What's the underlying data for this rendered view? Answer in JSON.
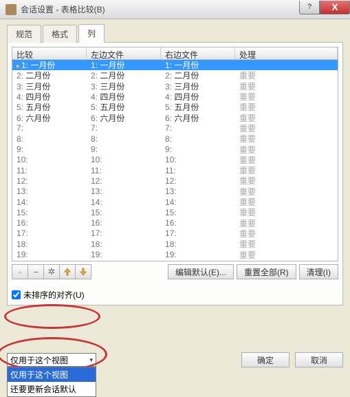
{
  "window": {
    "title": "会话设置 - 表格比较(B)",
    "help_glyph": "?",
    "close_glyph": "X"
  },
  "tabs": [
    {
      "label": "规范"
    },
    {
      "label": "格式"
    },
    {
      "label": "列",
      "active": true
    }
  ],
  "columns": {
    "compare": "比较",
    "left": "左边文件",
    "right": "右边文件",
    "handle": "处理"
  },
  "rows": [
    {
      "idx": "1:",
      "compare": "一月份",
      "left": "一月份",
      "right": "一月份",
      "handle": "",
      "selected": true
    },
    {
      "idx": "2:",
      "compare": "二月份",
      "left": "二月份",
      "right": "二月份",
      "handle": "重要"
    },
    {
      "idx": "3:",
      "compare": "三月份",
      "left": "三月份",
      "right": "三月份",
      "handle": "重要"
    },
    {
      "idx": "4:",
      "compare": "四月份",
      "left": "四月份",
      "right": "四月份",
      "handle": "重要"
    },
    {
      "idx": "5:",
      "compare": "五月份",
      "left": "五月份",
      "right": "五月份",
      "handle": "重要"
    },
    {
      "idx": "6:",
      "compare": "六月份",
      "left": "六月份",
      "right": "六月份",
      "handle": "重要"
    },
    {
      "idx": "7:",
      "compare": "",
      "left": "",
      "right": "",
      "handle": "重要"
    },
    {
      "idx": "8:",
      "compare": "",
      "left": "",
      "right": "",
      "handle": "重要"
    },
    {
      "idx": "9:",
      "compare": "",
      "left": "",
      "right": "",
      "handle": "重要"
    },
    {
      "idx": "10:",
      "compare": "",
      "left": "",
      "right": "",
      "handle": "重要"
    },
    {
      "idx": "11:",
      "compare": "",
      "left": "",
      "right": "",
      "handle": "重要"
    },
    {
      "idx": "12:",
      "compare": "",
      "left": "",
      "right": "",
      "handle": "重要"
    },
    {
      "idx": "13:",
      "compare": "",
      "left": "",
      "right": "",
      "handle": "重要"
    },
    {
      "idx": "14:",
      "compare": "",
      "left": "",
      "right": "",
      "handle": "重要"
    },
    {
      "idx": "15:",
      "compare": "",
      "left": "",
      "right": "",
      "handle": "重要"
    },
    {
      "idx": "16:",
      "compare": "",
      "left": "",
      "right": "",
      "handle": "重要"
    },
    {
      "idx": "17:",
      "compare": "",
      "left": "",
      "right": "",
      "handle": "重要"
    },
    {
      "idx": "18:",
      "compare": "",
      "left": "",
      "right": "",
      "handle": "重要"
    },
    {
      "idx": "19:",
      "compare": "",
      "left": "",
      "right": "",
      "handle": "重要"
    }
  ],
  "toolbar": {
    "add": "+",
    "remove": "−",
    "gear": "✲",
    "up": "↑",
    "down": "↓",
    "edit_default": "编辑默认(E)...",
    "reset_all": "重置全部(R)",
    "clear": "清理(I)"
  },
  "checkbox": {
    "unsorted_align": "未排序的对齐(U)",
    "checked": true
  },
  "dropdown": {
    "selected": "仅用于这个视图",
    "options": [
      "仅用于这个视图",
      "还要更新会话默认"
    ]
  },
  "buttons": {
    "ok": "确定",
    "cancel": "取消"
  }
}
